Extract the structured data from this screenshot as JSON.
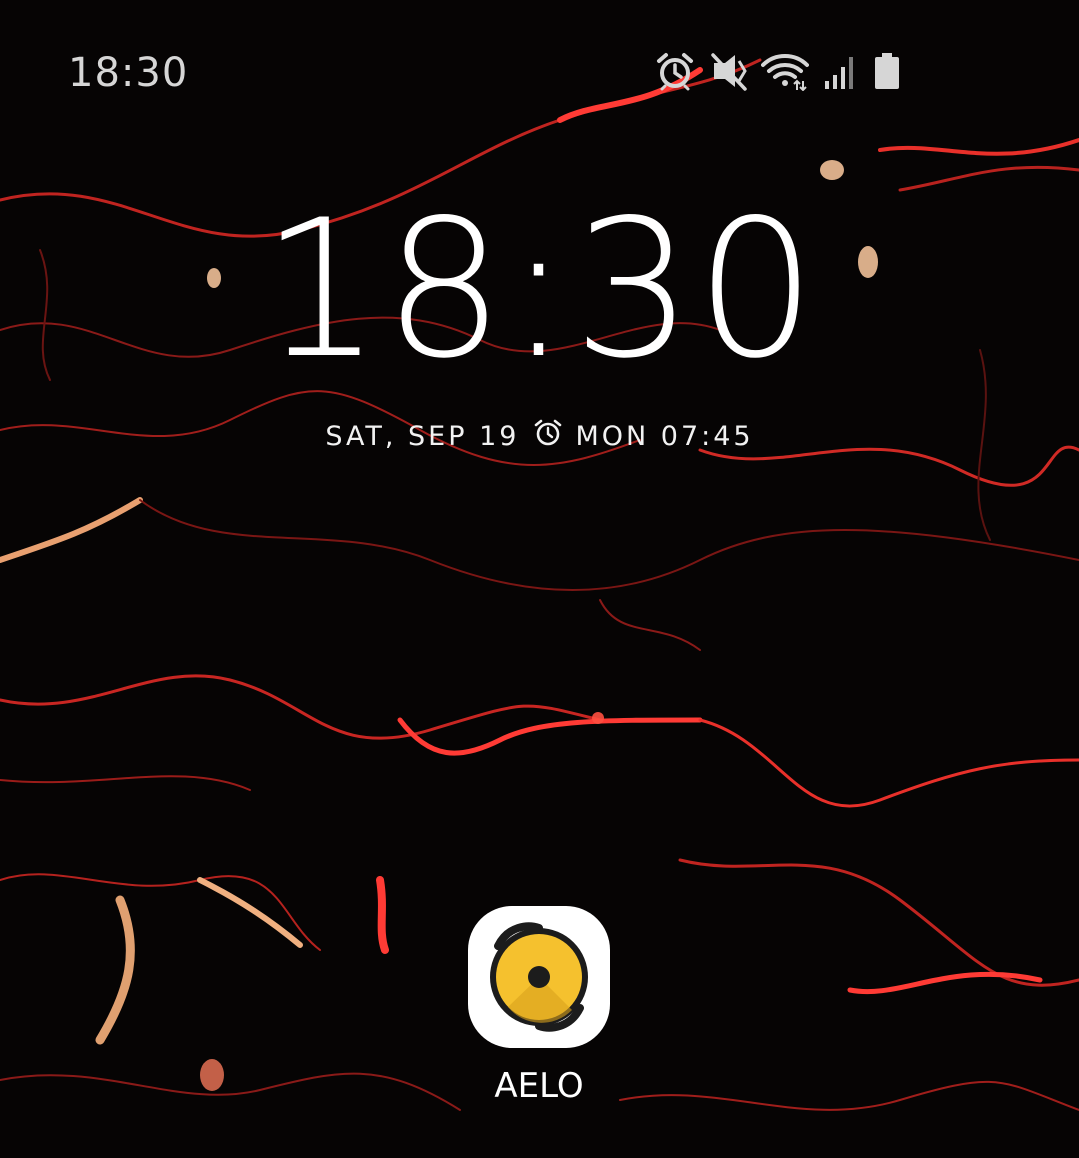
{
  "status_bar": {
    "time": "18:30",
    "icons": [
      "alarm-icon",
      "vibrate-icon",
      "wifi-icon",
      "signal-icon",
      "battery-icon"
    ]
  },
  "lock_screen": {
    "clock": "18:30",
    "date": "SAT, SEP 19",
    "alarm_icon": "alarm-icon",
    "next_alarm": "MON 07:45"
  },
  "app_shortcut": {
    "label": "AELO",
    "icon": "aelo-app-icon",
    "icon_color": "#F5C12E"
  },
  "colors": {
    "wallpaper_base": "#060404",
    "wallpaper_veins": "#E8302A"
  }
}
